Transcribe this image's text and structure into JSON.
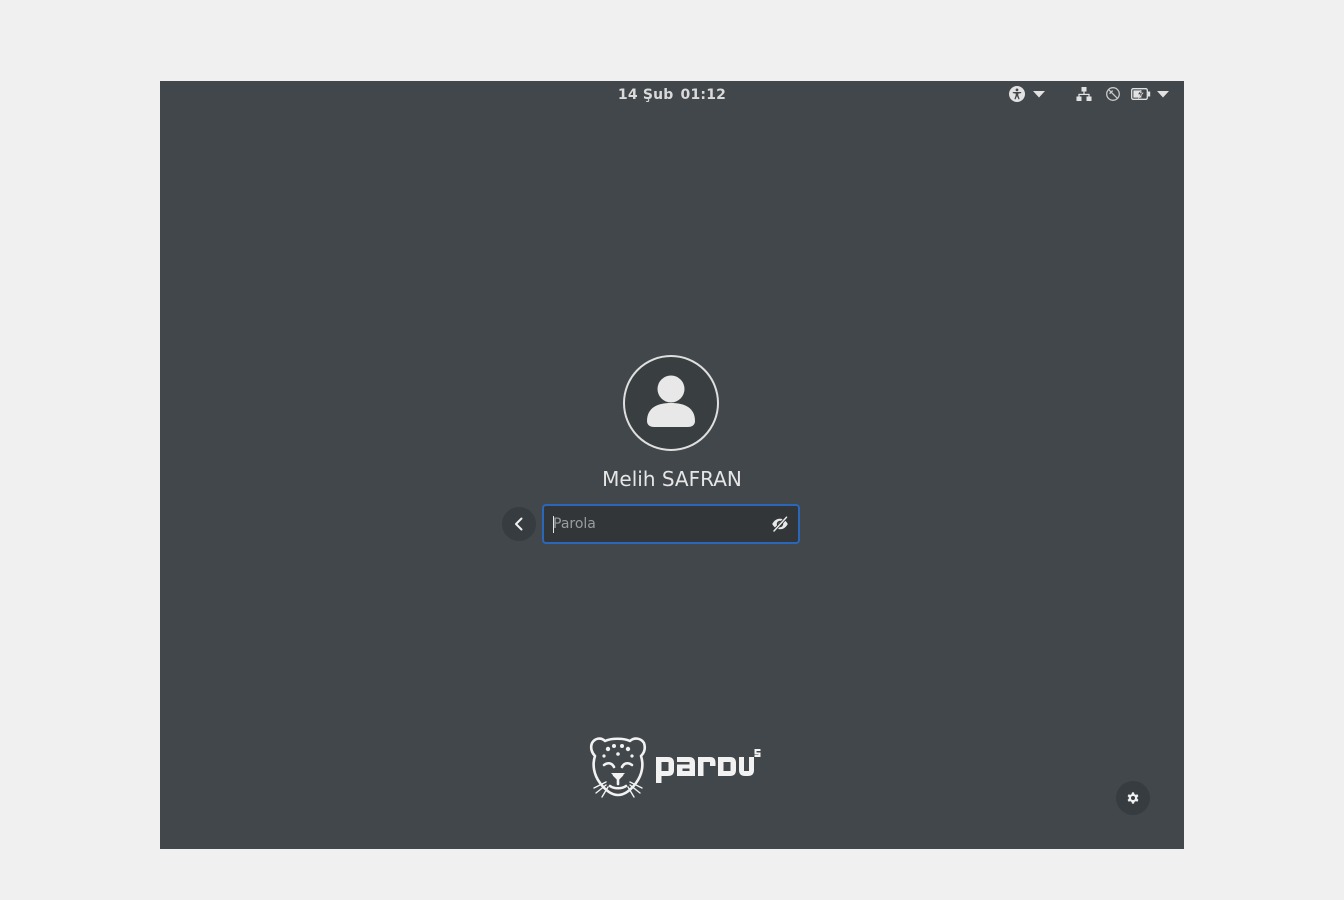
{
  "topbar": {
    "date": "14 Şub",
    "time": "01:12",
    "icons": [
      "accessibility-icon",
      "chevron-down-icon",
      "network-wired-icon",
      "no-connection-icon",
      "battery-charging-icon",
      "chevron-down-icon"
    ]
  },
  "login": {
    "user_name": "Melih SAFRAN",
    "password_placeholder": "Parola",
    "avatar_icon": "user-avatar-icon",
    "back_icon": "chevron-left-icon",
    "reveal_icon": "eye-hidden-icon"
  },
  "branding": {
    "logo_text": "pardus",
    "logo_version": "21"
  },
  "footer": {
    "settings_icon": "gear-icon"
  },
  "colors": {
    "background": "#41474b",
    "focus_border": "#2b67b8",
    "text": "#e6e6e6"
  }
}
